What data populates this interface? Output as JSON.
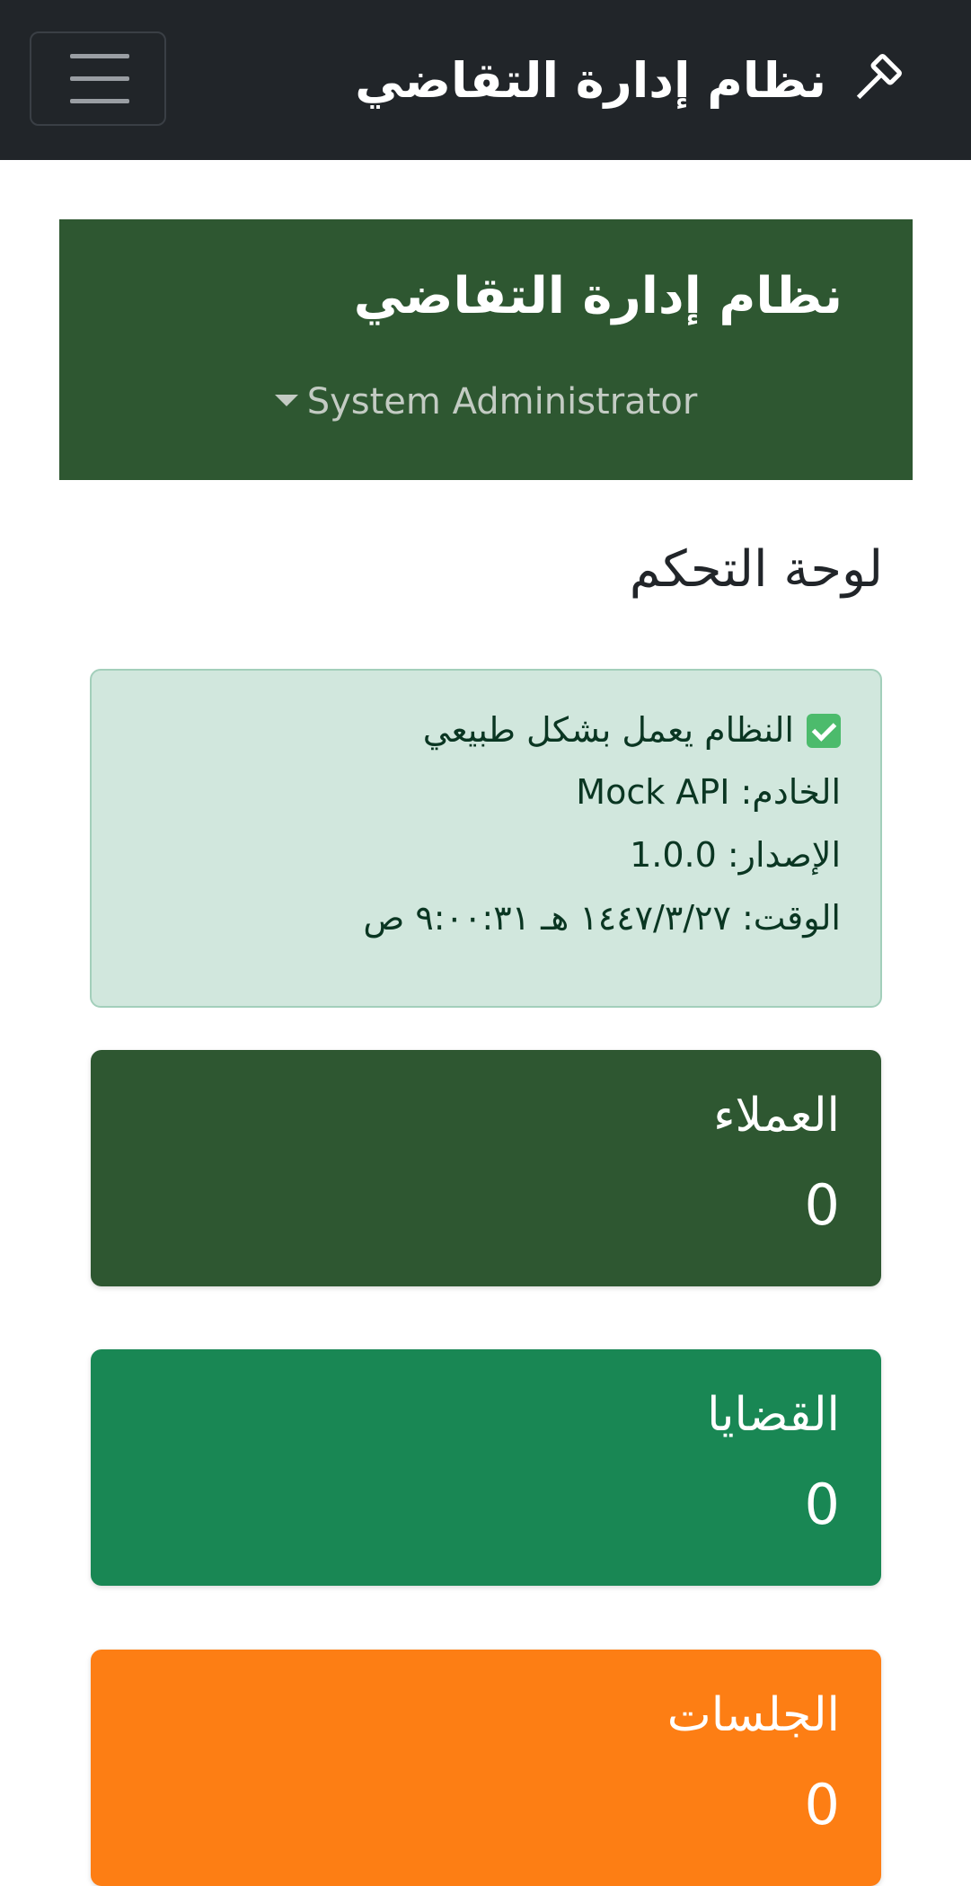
{
  "navbar": {
    "brand_text": "نظام إدارة التقاضي",
    "brand_icon": "gavel-icon",
    "toggler_icon": "hamburger-menu-icon"
  },
  "sidebar": {
    "title": "نظام إدارة التقاضي",
    "user_name": "System Administrator"
  },
  "page": {
    "title": "لوحة التحكم"
  },
  "system_status": {
    "message": "النظام يعمل بشكل طبيعي",
    "server": "الخادم: Mock API",
    "version": "الإصدار: 1.0.0",
    "time": "الوقت: ١٤٤٧/٣/٢٧ هـ ٩:٠٠:٣١ ص",
    "colors": {
      "background": "#d1e7dd",
      "border": "#a3cfbb",
      "text": "#0a3622"
    }
  },
  "stats": [
    {
      "label": "العملاء",
      "value": "0",
      "color": "#2e5731"
    },
    {
      "label": "القضايا",
      "value": "0",
      "color": "#198754"
    },
    {
      "label": "الجلسات",
      "value": "0",
      "color": "#fd7e14"
    }
  ],
  "colors": {
    "navbar": "#212529",
    "sidebar_header": "#2e5731"
  }
}
